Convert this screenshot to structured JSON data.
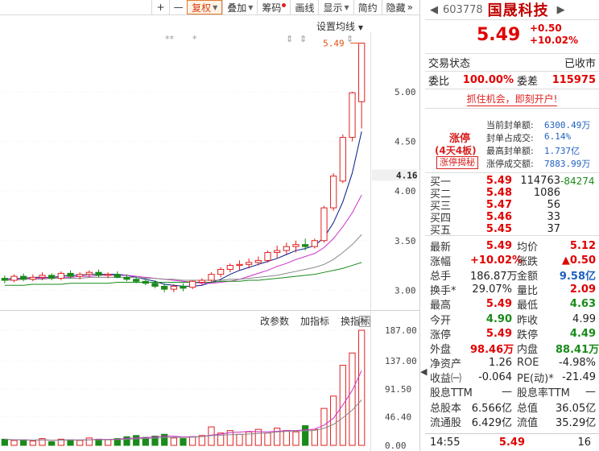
{
  "toolbar": {
    "plus": "+",
    "minus": "—",
    "fq": "复权",
    "overlay": "叠加",
    "chip": "筹码",
    "draw": "画线",
    "display": "显示",
    "simple": "简约",
    "hide": "隐藏",
    "more": "»"
  },
  "chart": {
    "settings_ma": "设置均线",
    "last_price_tag": "5.49",
    "current_price_label": "4.16",
    "y_upper_ticks": [
      "5.00",
      "4.50",
      "4.00",
      "3.50",
      "3.00"
    ],
    "y_lower_ticks": [
      "187.00",
      "137.00",
      "91.50",
      "46.40",
      "0.00"
    ],
    "sub_tabs": [
      "改参数",
      "加指标",
      "换指标"
    ],
    "close": "×",
    "collapse": "◀",
    "colors": {
      "up": "#e02020",
      "down": "#1a8a1a",
      "ma5": "#001a8c",
      "ma10": "#cc2ecc",
      "ma20": "#888888",
      "ma60": "#1a8a1a"
    }
  },
  "stock": {
    "code": "603778",
    "name": "国晟科技",
    "price": "5.49",
    "change": "+0.50",
    "change_pct": "+10.02%",
    "state_label": "交易状态",
    "state_value": "已收市",
    "wb_label": "委比",
    "wb_value": "100.00%",
    "wc_label": "委差",
    "wc_value": "115975",
    "ad": "抓住机会，即刻开户!",
    "zt_label": "涨停",
    "zt_days": "(4天4板)",
    "zt_btn": "涨停揭秘",
    "zt_rows": [
      {
        "label": "当前封单额:",
        "value": "6300.49万"
      },
      {
        "label": "封单占成交:",
        "value": "6.14%"
      },
      {
        "label": "最高封单额:",
        "value": "1.737亿"
      },
      {
        "label": "涨停成交额:",
        "value": "7883.99万"
      }
    ],
    "orderbook": [
      {
        "label": "买一",
        "price": "5.49",
        "vol": "114763",
        "extra": "-84274"
      },
      {
        "label": "买二",
        "price": "5.48",
        "vol": "1086",
        "extra": ""
      },
      {
        "label": "买三",
        "price": "5.47",
        "vol": "56",
        "extra": ""
      },
      {
        "label": "买四",
        "price": "5.46",
        "vol": "33",
        "extra": ""
      },
      {
        "label": "买五",
        "price": "5.45",
        "vol": "37",
        "extra": ""
      }
    ],
    "stats": [
      {
        "a": "最新",
        "b": "5.49",
        "bc": "red",
        "c": "均价",
        "d": "5.12",
        "dc": "red"
      },
      {
        "a": "涨幅",
        "b": "+10.02%",
        "bc": "red",
        "c": "涨跌",
        "d": "▲0.50",
        "dc": "red"
      },
      {
        "a": "总手",
        "b": "186.87万",
        "bc": "blk",
        "c": "金额",
        "d": "9.58亿",
        "dc": "blu"
      },
      {
        "a": "换手*",
        "b": "29.07%",
        "bc": "blk",
        "c": "量比",
        "d": "2.09",
        "dc": "red"
      },
      {
        "a": "最高",
        "b": "5.49",
        "bc": "red",
        "c": "最低",
        "d": "4.63",
        "dc": "grn"
      },
      {
        "a": "今开",
        "b": "4.90",
        "bc": "grn",
        "c": "昨收",
        "d": "4.99",
        "dc": "blk"
      },
      {
        "a": "涨停",
        "b": "5.49",
        "bc": "red",
        "c": "跌停",
        "d": "4.49",
        "dc": "grn"
      },
      {
        "a": "外盘",
        "b": "98.46万",
        "bc": "red",
        "c": "内盘",
        "d": "88.41万",
        "dc": "grn"
      },
      {
        "a": "净资产",
        "b": "1.26",
        "bc": "blk",
        "c": "ROE",
        "d": "-4.98%",
        "dc": "blk"
      },
      {
        "a": "收益㈠",
        "b": "-0.064",
        "bc": "blk",
        "c": "PE(动)*",
        "d": "-21.49",
        "dc": "blk"
      },
      {
        "a": "股息TTM",
        "b": "—",
        "bc": "blk",
        "c": "股息率TTM",
        "d": "—",
        "dc": "blk"
      },
      {
        "a": "总股本",
        "b": "6.566亿",
        "bc": "blk",
        "c": "总值",
        "d": "36.05亿",
        "dc": "blk"
      },
      {
        "a": "流通股",
        "b": "6.429亿",
        "bc": "blk",
        "c": "流值",
        "d": "35.29亿",
        "dc": "blk"
      }
    ],
    "tick": {
      "time": "14:55",
      "price": "5.49",
      "vol": "16"
    }
  },
  "chart_data": {
    "type": "candlestick",
    "price_range": [
      2.8,
      5.6
    ],
    "volume_range": [
      0,
      187
    ],
    "candles": [
      [
        3.12,
        3.15,
        3.07,
        3.1
      ],
      [
        3.1,
        3.16,
        3.08,
        3.14
      ],
      [
        3.14,
        3.17,
        3.09,
        3.11
      ],
      [
        3.11,
        3.16,
        3.09,
        3.13
      ],
      [
        3.13,
        3.18,
        3.1,
        3.15
      ],
      [
        3.15,
        3.17,
        3.1,
        3.12
      ],
      [
        3.12,
        3.19,
        3.1,
        3.17
      ],
      [
        3.17,
        3.2,
        3.12,
        3.14
      ],
      [
        3.14,
        3.18,
        3.11,
        3.16
      ],
      [
        3.16,
        3.2,
        3.13,
        3.18
      ],
      [
        3.18,
        3.21,
        3.13,
        3.15
      ],
      [
        3.15,
        3.18,
        3.12,
        3.16
      ],
      [
        3.16,
        3.19,
        3.12,
        3.13
      ],
      [
        3.13,
        3.16,
        3.09,
        3.11
      ],
      [
        3.11,
        3.14,
        3.07,
        3.09
      ],
      [
        3.09,
        3.12,
        3.05,
        3.07
      ],
      [
        3.07,
        3.1,
        3.02,
        3.04
      ],
      [
        3.04,
        3.07,
        2.98,
        3.01
      ],
      [
        3.01,
        3.06,
        2.98,
        3.04
      ],
      [
        3.04,
        3.07,
        2.99,
        3.02
      ],
      [
        3.03,
        3.1,
        3.01,
        3.09
      ],
      [
        3.08,
        3.12,
        3.05,
        3.1
      ],
      [
        3.1,
        3.18,
        3.08,
        3.16
      ],
      [
        3.16,
        3.23,
        3.13,
        3.21
      ],
      [
        3.21,
        3.27,
        3.18,
        3.25
      ],
      [
        3.25,
        3.3,
        3.2,
        3.26
      ],
      [
        3.26,
        3.32,
        3.22,
        3.28
      ],
      [
        3.28,
        3.34,
        3.25,
        3.3
      ],
      [
        3.3,
        3.4,
        3.28,
        3.38
      ],
      [
        3.38,
        3.45,
        3.32,
        3.4
      ],
      [
        3.4,
        3.48,
        3.36,
        3.44
      ],
      [
        3.44,
        3.5,
        3.38,
        3.46
      ],
      [
        3.46,
        3.52,
        3.4,
        3.44
      ],
      [
        3.44,
        3.52,
        3.42,
        3.5
      ],
      [
        3.5,
        3.85,
        3.48,
        3.83
      ],
      [
        3.83,
        4.18,
        3.8,
        4.15
      ],
      [
        4.1,
        4.57,
        4.08,
        4.54
      ],
      [
        4.54,
        5.0,
        4.5,
        4.99
      ],
      [
        4.9,
        5.49,
        4.63,
        5.49
      ]
    ],
    "volumes": [
      10,
      8,
      9,
      7,
      11,
      6,
      10,
      9,
      8,
      12,
      10,
      9,
      11,
      14,
      16,
      13,
      15,
      18,
      12,
      11,
      14,
      16,
      30,
      20,
      24,
      18,
      22,
      26,
      20,
      28,
      24,
      22,
      32,
      26,
      60,
      80,
      130,
      150,
      187
    ],
    "series": [
      {
        "name": "MA5",
        "values": [
          3.11,
          3.12,
          3.12,
          3.13,
          3.13,
          3.13,
          3.14,
          3.15,
          3.15,
          3.16,
          3.16,
          3.16,
          3.16,
          3.15,
          3.13,
          3.11,
          3.09,
          3.06,
          3.05,
          3.04,
          3.04,
          3.05,
          3.08,
          3.11,
          3.16,
          3.2,
          3.23,
          3.26,
          3.29,
          3.32,
          3.36,
          3.4,
          3.42,
          3.45,
          3.53,
          3.68,
          3.89,
          4.18,
          4.6
        ]
      },
      {
        "name": "MA10",
        "values": [
          3.11,
          3.11,
          3.12,
          3.12,
          3.12,
          3.13,
          3.13,
          3.13,
          3.14,
          3.14,
          3.15,
          3.15,
          3.15,
          3.15,
          3.14,
          3.13,
          3.12,
          3.11,
          3.1,
          3.09,
          3.08,
          3.07,
          3.07,
          3.08,
          3.09,
          3.11,
          3.14,
          3.17,
          3.2,
          3.24,
          3.27,
          3.31,
          3.34,
          3.37,
          3.43,
          3.52,
          3.64,
          3.78,
          3.96
        ]
      },
      {
        "name": "MA20",
        "values": [
          3.1,
          3.1,
          3.11,
          3.11,
          3.11,
          3.12,
          3.12,
          3.12,
          3.12,
          3.13,
          3.13,
          3.13,
          3.13,
          3.13,
          3.13,
          3.12,
          3.12,
          3.11,
          3.11,
          3.1,
          3.1,
          3.1,
          3.1,
          3.1,
          3.11,
          3.11,
          3.12,
          3.13,
          3.14,
          3.15,
          3.17,
          3.19,
          3.21,
          3.23,
          3.26,
          3.31,
          3.38,
          3.46,
          3.56
        ]
      },
      {
        "name": "MA60",
        "values": [
          3.05,
          3.05,
          3.05,
          3.06,
          3.06,
          3.06,
          3.06,
          3.07,
          3.07,
          3.07,
          3.07,
          3.07,
          3.08,
          3.08,
          3.08,
          3.08,
          3.08,
          3.08,
          3.08,
          3.08,
          3.08,
          3.08,
          3.08,
          3.09,
          3.09,
          3.09,
          3.1,
          3.1,
          3.11,
          3.12,
          3.13,
          3.14,
          3.15,
          3.16,
          3.18,
          3.2,
          3.22,
          3.25,
          3.28
        ]
      }
    ]
  }
}
